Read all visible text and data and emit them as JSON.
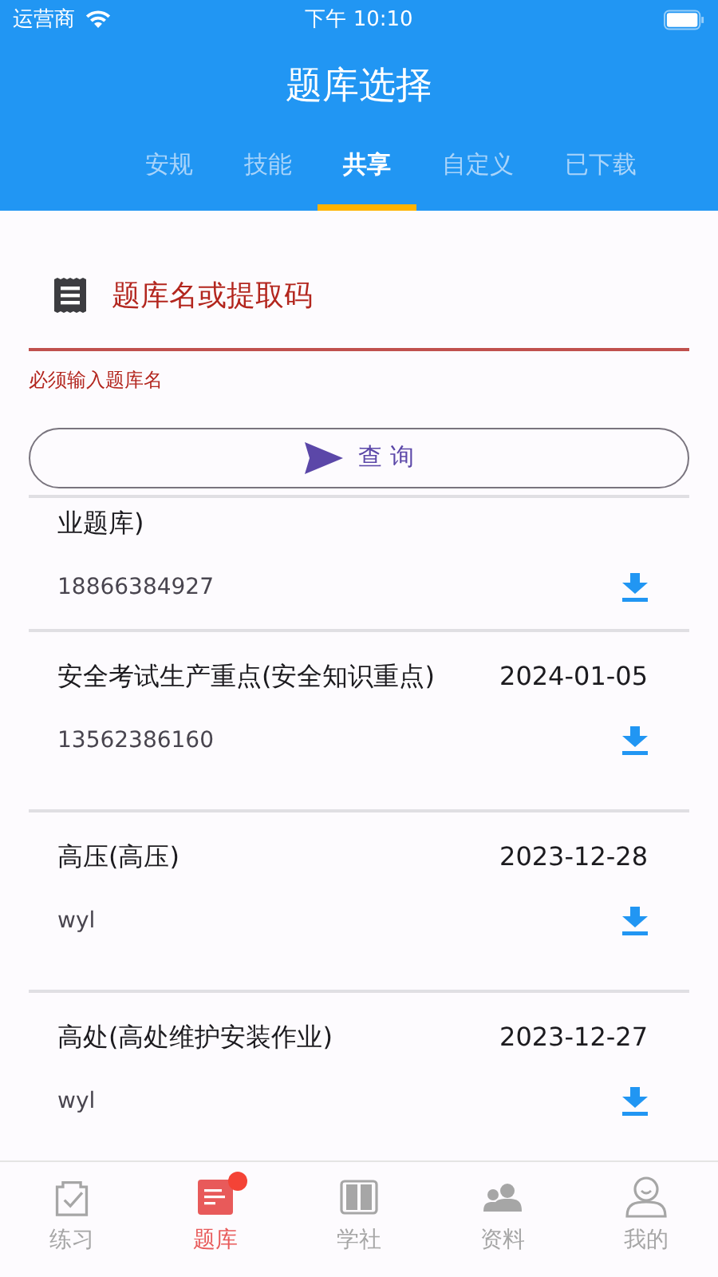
{
  "status_bar": {
    "carrier": "运营商",
    "time": "下午 10:10"
  },
  "header": {
    "title": "题库选择"
  },
  "tabs": [
    {
      "label": "安规",
      "selected": false
    },
    {
      "label": "技能",
      "selected": false
    },
    {
      "label": "共享",
      "selected": true
    },
    {
      "label": "自定义",
      "selected": false
    },
    {
      "label": "已下载",
      "selected": false
    }
  ],
  "search": {
    "placeholder": "题库名或提取码",
    "error": "必须输入题库名",
    "button": "查 询"
  },
  "banks": [
    {
      "name": "业题库)",
      "code": "18866384927"
    },
    {
      "name": "安全考试生产重点(安全知识重点)",
      "date": "2024-01-05",
      "code": "13562386160"
    },
    {
      "name": "高压(高压)",
      "date": "2023-12-28",
      "code": "wyl"
    },
    {
      "name": "高处(高处维护安装作业)",
      "date": "2023-12-27",
      "code": "wyl"
    }
  ],
  "nav": [
    {
      "label": "练习",
      "selected": false,
      "badge": false
    },
    {
      "label": "题库",
      "selected": true,
      "badge": true
    },
    {
      "label": "学社",
      "selected": false,
      "badge": false
    },
    {
      "label": "资料",
      "selected": false,
      "badge": false
    },
    {
      "label": "我的",
      "selected": false,
      "badge": false
    }
  ]
}
